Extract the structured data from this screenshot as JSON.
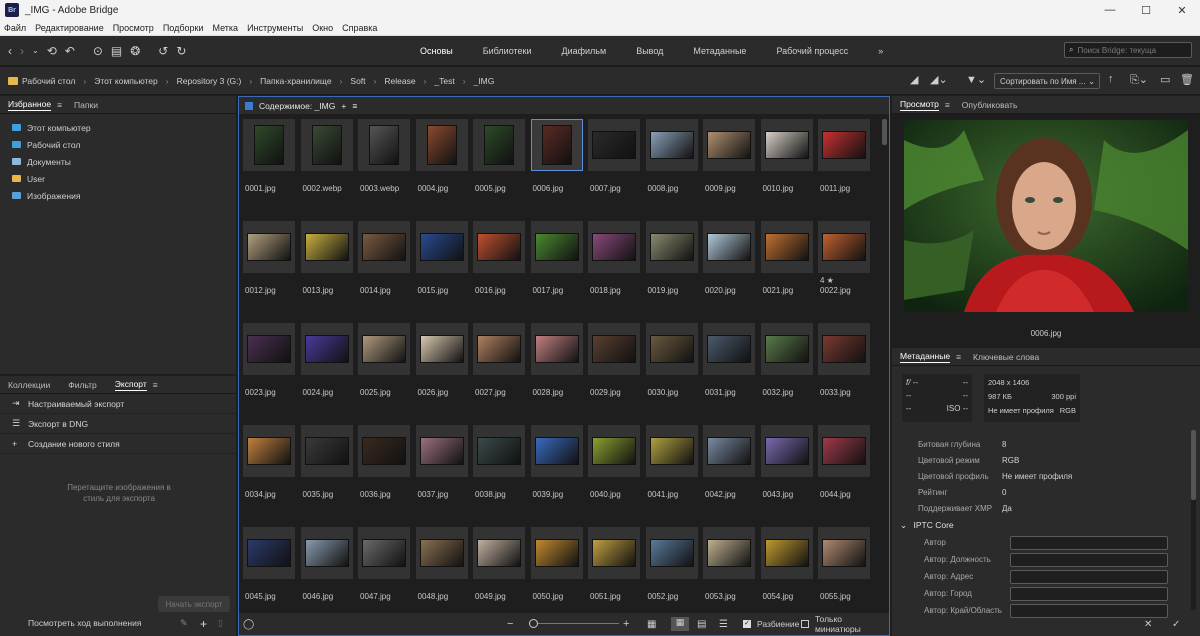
{
  "window": {
    "title": "_IMG - Adobe Bridge",
    "logo": "Br"
  },
  "menu": [
    "Файл",
    "Редактирование",
    "Просмотр",
    "Подборки",
    "Метка",
    "Инструменты",
    "Окно",
    "Справка"
  ],
  "workspaces": [
    "Основы",
    "Библиотеки",
    "Диафильм",
    "Вывод",
    "Метаданные",
    "Рабочий процесс"
  ],
  "search": {
    "placeholder": "Поиск Bridge: текуща"
  },
  "breadcrumb": [
    "Рабочий стол",
    "Этот компьютер",
    "Repository 3 (G:)",
    "Папка-хранилище",
    "Soft",
    "Release",
    "_Test",
    "_IMG"
  ],
  "sort": {
    "label": "Сортировать по Имя ..."
  },
  "left_top": {
    "tabs": [
      "Избранное",
      "Папки"
    ],
    "items": [
      {
        "label": "Этот компьютер",
        "color": "#3fa0e0"
      },
      {
        "label": "Рабочий стол",
        "color": "#3fa0e0"
      },
      {
        "label": "Документы",
        "color": "#8fb8d8"
      },
      {
        "label": "User",
        "color": "#e7b74b"
      },
      {
        "label": "Изображения",
        "color": "#5aa0d8"
      }
    ]
  },
  "left_bottom": {
    "tabs": [
      "Коллекции",
      "Фильтр",
      "Экспорт"
    ],
    "items": [
      {
        "icon": "export-icon",
        "label": "Настраиваемый экспорт"
      },
      {
        "icon": "list-icon",
        "label": "Экспорт в DNG"
      },
      {
        "icon": "plus-icon",
        "label": "Создание нового стиля"
      }
    ],
    "hint": "Перетащите изображения в стиль для экспорта",
    "start_button": "Начать экспорт",
    "progress_link": "Посмотреть ход выполнения"
  },
  "content": {
    "title": "Содержимое: _IMG",
    "files": [
      {
        "name": "0001.jpg",
        "c": "#2f4a2a",
        "p": true
      },
      {
        "name": "0002.webp",
        "c": "#3a4a34",
        "p": true
      },
      {
        "name": "0003.webp",
        "c": "#555",
        "p": true
      },
      {
        "name": "0004.jpg",
        "c": "#8a4a30",
        "p": true
      },
      {
        "name": "0005.jpg",
        "c": "#2d4a28",
        "p": true
      },
      {
        "name": "0006.jpg",
        "c": "#5a2a22",
        "p": true
      },
      {
        "name": "0007.jpg",
        "c": "#2a2a2a",
        "p": false
      },
      {
        "name": "0008.jpg",
        "c": "#8aa0b8",
        "p": false
      },
      {
        "name": "0009.jpg",
        "c": "#b09070",
        "p": false
      },
      {
        "name": "0010.jpg",
        "c": "#d8d0c8",
        "p": false
      },
      {
        "name": "0011.jpg",
        "c": "#c83030",
        "p": false
      },
      {
        "name": "0012.jpg",
        "c": "#b0a080",
        "p": false
      },
      {
        "name": "0013.jpg",
        "c": "#c8b040",
        "p": false
      },
      {
        "name": "0014.jpg",
        "c": "#7a5a40",
        "p": false
      },
      {
        "name": "0015.jpg",
        "c": "#2a4a90",
        "p": false
      },
      {
        "name": "0016.jpg",
        "c": "#c05030",
        "p": false
      },
      {
        "name": "0017.jpg",
        "c": "#4a8a30",
        "p": false
      },
      {
        "name": "0018.jpg",
        "c": "#8a4a7a",
        "p": false
      },
      {
        "name": "0019.jpg",
        "c": "#8a8a70",
        "p": false
      },
      {
        "name": "0020.jpg",
        "c": "#b0c8d8",
        "p": false
      },
      {
        "name": "0021.jpg",
        "c": "#c07030",
        "p": false
      },
      {
        "name": "0022.jpg",
        "c": "#c06030",
        "p": false,
        "stars": "4 ★"
      },
      {
        "name": "0023.jpg",
        "c": "#4a3050",
        "p": false
      },
      {
        "name": "0024.jpg",
        "c": "#4a3a9a",
        "p": false
      },
      {
        "name": "0025.jpg",
        "c": "#b09a80",
        "p": false
      },
      {
        "name": "0026.jpg",
        "c": "#d8c8b0",
        "p": false
      },
      {
        "name": "0027.jpg",
        "c": "#b08060",
        "p": false
      },
      {
        "name": "0028.jpg",
        "c": "#c08080",
        "p": false
      },
      {
        "name": "0029.jpg",
        "c": "#5a4030",
        "p": false
      },
      {
        "name": "0030.jpg",
        "c": "#6a5a40",
        "p": false
      },
      {
        "name": "0031.jpg",
        "c": "#4a5a6a",
        "p": false
      },
      {
        "name": "0032.jpg",
        "c": "#5a7a4a",
        "p": false
      },
      {
        "name": "0033.jpg",
        "c": "#7a3a30",
        "p": false
      },
      {
        "name": "0034.jpg",
        "c": "#c08040",
        "p": false
      },
      {
        "name": "0035.jpg",
        "c": "#3a3a3a",
        "p": false
      },
      {
        "name": "0036.jpg",
        "c": "#3a2a20",
        "p": false
      },
      {
        "name": "0037.jpg",
        "c": "#9a7080",
        "p": false
      },
      {
        "name": "0038.jpg",
        "c": "#3a4a4a",
        "p": false
      },
      {
        "name": "0039.jpg",
        "c": "#3a6ac0",
        "p": false
      },
      {
        "name": "0040.jpg",
        "c": "#8aa030",
        "p": false
      },
      {
        "name": "0041.jpg",
        "c": "#b0a040",
        "p": false
      },
      {
        "name": "0042.jpg",
        "c": "#7a8aa0",
        "p": false
      },
      {
        "name": "0043.jpg",
        "c": "#7a6ab0",
        "p": false
      },
      {
        "name": "0044.jpg",
        "c": "#a03a4a",
        "p": false
      },
      {
        "name": "0045.jpg",
        "c": "#2a3a6a",
        "p": false
      },
      {
        "name": "0046.jpg",
        "c": "#8a9ab0",
        "p": false
      },
      {
        "name": "0047.jpg",
        "c": "#6a6a6a",
        "p": false
      },
      {
        "name": "0048.jpg",
        "c": "#8a7050",
        "p": false
      },
      {
        "name": "0049.jpg",
        "c": "#c0b0a0",
        "p": false
      },
      {
        "name": "0050.jpg",
        "c": "#c08a30",
        "p": false
      },
      {
        "name": "0051.jpg",
        "c": "#c0a040",
        "p": false
      },
      {
        "name": "0052.jpg",
        "c": "#5a7a9a",
        "p": false
      },
      {
        "name": "0053.jpg",
        "c": "#c0b090",
        "p": false
      },
      {
        "name": "0054.jpg",
        "c": "#c09a30",
        "p": false
      },
      {
        "name": "0055.jpg",
        "c": "#b08a70",
        "p": false
      }
    ],
    "footer": {
      "split_label": "Разбиение",
      "thumbs_only_label": "Только миниатюры"
    }
  },
  "preview": {
    "tabs": [
      "Просмотр",
      "Опубликовать"
    ],
    "filename": "0006.jpg"
  },
  "metadata": {
    "tabs": [
      "Метаданные",
      "Ключевые слова"
    ],
    "summary": {
      "fstop": "f/ --",
      "dash": "--",
      "iso": "ISO --",
      "dims": "2048 x 1406",
      "size": "987 КБ",
      "ppi": "300 ppi",
      "profile": "Не имеет профиля",
      "mode": "RGB"
    },
    "rows": [
      {
        "k": "Битовая глубина",
        "v": "8"
      },
      {
        "k": "Цветовой режим",
        "v": "RGB"
      },
      {
        "k": "Цветовой профиль",
        "v": "Не имеет профиля"
      },
      {
        "k": "Рейтинг",
        "v": "0"
      },
      {
        "k": "Поддерживает XMP",
        "v": "Да"
      }
    ],
    "iptc_title": "IPTC Core",
    "iptc_fields": [
      "Автор",
      "Автор: Должность",
      "Автор: Адрес",
      "Автор: Город",
      "Автор: Край/Область"
    ]
  }
}
